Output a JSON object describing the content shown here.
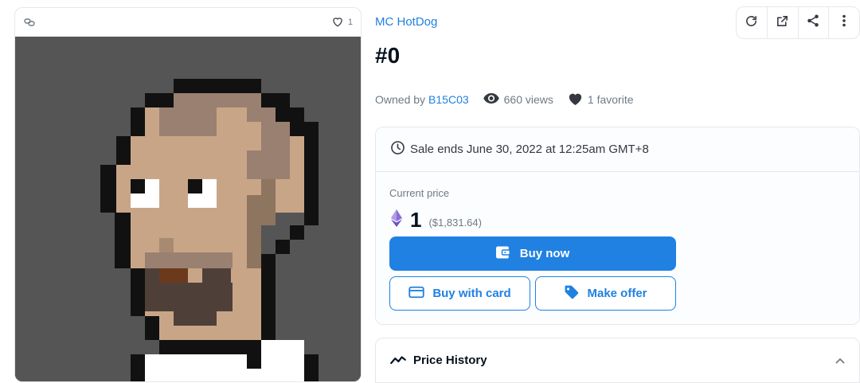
{
  "image_card": {
    "favorite_count": "1",
    "icons": {
      "chain": "link-chain-icon",
      "heart": "heart-outline-icon"
    }
  },
  "item": {
    "collection": "MC HotDog",
    "title": "#0",
    "owned_by_label": "Owned by",
    "owner": "B15C03",
    "views": "660 views",
    "favorites": "1 favorite"
  },
  "toolbar": {
    "icons": [
      "refresh-icon",
      "external-link-icon",
      "share-icon",
      "more-vertical-icon"
    ]
  },
  "sale": {
    "ends_text": "Sale ends June 30, 2022 at 12:25am GMT+8",
    "current_price_label": "Current price",
    "price_eth": "1",
    "price_usd": "($1,831.64)",
    "buy_now_label": "Buy now",
    "buy_card_label": "Buy with card",
    "offer_label": "Make offer"
  },
  "price_history": {
    "title": "Price History"
  },
  "colors": {
    "accent": "#2081e2",
    "text": "#04111d",
    "muted": "#707a83",
    "border": "#e5e8eb",
    "eth_purple": "#8a6cd8"
  }
}
